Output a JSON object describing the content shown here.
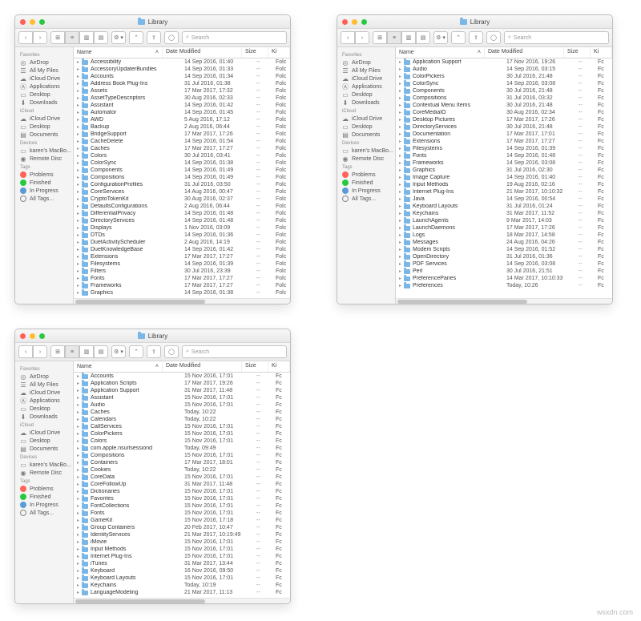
{
  "watermark": "wsxdn.com",
  "window_title_label": "Library",
  "search_placeholder": "Search",
  "columns": {
    "name": "Name",
    "date": "Date Modified",
    "size": "Size",
    "kind": "Ki"
  },
  "sidebar": {
    "groups": [
      {
        "header": "Favorites",
        "items": [
          {
            "icon": "airdrop",
            "label": "AirDrop"
          },
          {
            "icon": "allfiles",
            "label": "All My Files"
          },
          {
            "icon": "cloud",
            "label": "iCloud Drive"
          },
          {
            "icon": "apps",
            "label": "Applications"
          },
          {
            "icon": "desktop",
            "label": "Desktop"
          },
          {
            "icon": "downloads",
            "label": "Downloads"
          }
        ]
      },
      {
        "header": "iCloud",
        "items": [
          {
            "icon": "cloud",
            "label": "iCloud Drive"
          },
          {
            "icon": "desktop",
            "label": "Desktop"
          },
          {
            "icon": "docs",
            "label": "Documents"
          }
        ]
      },
      {
        "header": "Devices",
        "items": [
          {
            "icon": "mac",
            "label": "karen's MacBo..."
          },
          {
            "icon": "disc",
            "label": "Remote Disc"
          }
        ]
      },
      {
        "header": "Tags",
        "items": [
          {
            "icon": "tag",
            "color": "#ff6259",
            "label": "Problems"
          },
          {
            "icon": "tag",
            "color": "#27c93f",
            "label": "Finished"
          },
          {
            "icon": "tag",
            "color": "#5b9bd5",
            "label": "In Progress"
          },
          {
            "icon": "tag",
            "color": "",
            "label": "All Tags..."
          }
        ]
      }
    ]
  },
  "windows": [
    {
      "rows": [
        {
          "n": "Accessibility",
          "d": "14 Sep 2016, 01:40",
          "s": "--",
          "k": "Folc"
        },
        {
          "n": "AccessoryUpdaterBundles",
          "d": "14 Sep 2016, 01:33",
          "s": "--",
          "k": "Folc"
        },
        {
          "n": "Accounts",
          "d": "14 Sep 2016, 01:34",
          "s": "--",
          "k": "Folc"
        },
        {
          "n": "Address Book Plug-Ins",
          "d": "31 Jul 2016, 01:38",
          "s": "--",
          "k": "Folc"
        },
        {
          "n": "Assets",
          "d": "17 Mar 2017, 17:32",
          "s": "--",
          "k": "Folc"
        },
        {
          "n": "AssetTypeDescriptors",
          "d": "30 Aug 2016, 02:33",
          "s": "--",
          "k": "Folc"
        },
        {
          "n": "Assistant",
          "d": "14 Sep 2016, 01:42",
          "s": "--",
          "k": "Folc"
        },
        {
          "n": "Automator",
          "d": "14 Sep 2016, 01:45",
          "s": "--",
          "k": "Folc"
        },
        {
          "n": "AWD",
          "d": "5 Aug 2016, 17:12",
          "s": "--",
          "k": "Folc"
        },
        {
          "n": "Backup",
          "d": "2 Aug 2016, 06:44",
          "s": "--",
          "k": "Folc"
        },
        {
          "n": "BridgeSupport",
          "d": "17 Mar 2017, 17:26",
          "s": "--",
          "k": "Folc"
        },
        {
          "n": "CacheDelete",
          "d": "14 Sep 2016, 01:54",
          "s": "--",
          "k": "Folc"
        },
        {
          "n": "Caches",
          "d": "17 Mar 2017, 17:27",
          "s": "--",
          "k": "Folc"
        },
        {
          "n": "Colors",
          "d": "30 Jul 2016, 03:41",
          "s": "--",
          "k": "Folc"
        },
        {
          "n": "ColorSync",
          "d": "14 Sep 2016, 01:38",
          "s": "--",
          "k": "Folc"
        },
        {
          "n": "Components",
          "d": "14 Sep 2016, 01:49",
          "s": "--",
          "k": "Folc"
        },
        {
          "n": "Compositions",
          "d": "14 Sep 2016, 01:49",
          "s": "--",
          "k": "Folc"
        },
        {
          "n": "ConfigurationProfiles",
          "d": "31 Jul 2016, 03:50",
          "s": "--",
          "k": "Folc"
        },
        {
          "n": "CoreServices",
          "d": "14 Aug 2016, 00:47",
          "s": "--",
          "k": "Folc"
        },
        {
          "n": "CryptoTokenKit",
          "d": "30 Aug 2016, 02:37",
          "s": "--",
          "k": "Folc"
        },
        {
          "n": "DefaultsConfigurations",
          "d": "2 Aug 2016, 06:44",
          "s": "--",
          "k": "Folc"
        },
        {
          "n": "DifferentialPrivacy",
          "d": "14 Sep 2016, 01:48",
          "s": "--",
          "k": "Folc"
        },
        {
          "n": "DirectoryServices",
          "d": "14 Sep 2016, 01:48",
          "s": "--",
          "k": "Folc"
        },
        {
          "n": "Displays",
          "d": "1 Nov 2016, 03:09",
          "s": "--",
          "k": "Folc"
        },
        {
          "n": "DTDs",
          "d": "14 Sep 2016, 01:36",
          "s": "--",
          "k": "Folc"
        },
        {
          "n": "DuetActivityScheduler",
          "d": "2 Aug 2016, 14:19",
          "s": "--",
          "k": "Folc"
        },
        {
          "n": "DuetKnowledgeBase",
          "d": "14 Sep 2016, 01:42",
          "s": "--",
          "k": "Folc"
        },
        {
          "n": "Extensions",
          "d": "17 Mar 2017, 17:27",
          "s": "--",
          "k": "Folc"
        },
        {
          "n": "Filesystems",
          "d": "14 Sep 2016, 01:39",
          "s": "--",
          "k": "Folc"
        },
        {
          "n": "Filters",
          "d": "30 Jul 2016, 23:39",
          "s": "--",
          "k": "Folc"
        },
        {
          "n": "Fonts",
          "d": "17 Mar 2017, 17:27",
          "s": "--",
          "k": "Folc"
        },
        {
          "n": "Frameworks",
          "d": "17 Mar 2017, 17:27",
          "s": "--",
          "k": "Folc"
        },
        {
          "n": "Graphics",
          "d": "14 Sep 2016, 01:38",
          "s": "--",
          "k": "Folc"
        }
      ]
    },
    {
      "rows": [
        {
          "n": "Application Support",
          "d": "17 Nov 2016, 19:26",
          "s": "--",
          "k": "Fc"
        },
        {
          "n": "Audio",
          "d": "14 Sep 2016, 03:15",
          "s": "--",
          "k": "Fc"
        },
        {
          "n": "ColorPickers",
          "d": "30 Jul 2016, 21:48",
          "s": "--",
          "k": "Fc"
        },
        {
          "n": "ColorSync",
          "d": "14 Sep 2016, 03:08",
          "s": "--",
          "k": "Fc"
        },
        {
          "n": "Components",
          "d": "30 Jul 2016, 21:48",
          "s": "--",
          "k": "Fc"
        },
        {
          "n": "Compositions",
          "d": "31 Jul 2016, 03:32",
          "s": "--",
          "k": "Fc"
        },
        {
          "n": "Contextual Menu Items",
          "d": "30 Jul 2016, 21:48",
          "s": "--",
          "k": "Fc"
        },
        {
          "n": "CoreMediaIO",
          "d": "30 Aug 2016, 02:34",
          "s": "--",
          "k": "Fc"
        },
        {
          "n": "Desktop Pictures",
          "d": "17 Mar 2017, 17:26",
          "s": "--",
          "k": "Fc"
        },
        {
          "n": "DirectoryServices",
          "d": "30 Jul 2016, 21:48",
          "s": "--",
          "k": "Fc"
        },
        {
          "n": "Documentation",
          "d": "17 Mar 2017, 17:01",
          "s": "--",
          "k": "Fc"
        },
        {
          "n": "Extensions",
          "d": "17 Mar 2017, 17:27",
          "s": "--",
          "k": "Fc"
        },
        {
          "n": "Filesystems",
          "d": "14 Sep 2016, 01:39",
          "s": "--",
          "k": "Fc"
        },
        {
          "n": "Fonts",
          "d": "14 Sep 2016, 01:48",
          "s": "--",
          "k": "Fc"
        },
        {
          "n": "Frameworks",
          "d": "14 Sep 2016, 03:08",
          "s": "--",
          "k": "Fc"
        },
        {
          "n": "Graphics",
          "d": "31 Jul 2016, 02:30",
          "s": "--",
          "k": "Fc"
        },
        {
          "n": "Image Capture",
          "d": "14 Sep 2016, 01:40",
          "s": "--",
          "k": "Fc"
        },
        {
          "n": "Input Methods",
          "d": "19 Aug 2016, 02:16",
          "s": "--",
          "k": "Fc"
        },
        {
          "n": "Internet Plug-Ins",
          "d": "21 Mar 2017, 10:10:32",
          "s": "--",
          "k": "Fc"
        },
        {
          "n": "Java",
          "d": "14 Sep 2016, 00:54",
          "s": "--",
          "k": "Fc"
        },
        {
          "n": "Keyboard Layouts",
          "d": "31 Jul 2016, 01:24",
          "s": "--",
          "k": "Fc"
        },
        {
          "n": "Keychains",
          "d": "31 Mar 2017, 11:52",
          "s": "--",
          "k": "Fc"
        },
        {
          "n": "LaunchAgents",
          "d": "9 Mar 2017, 14:03",
          "s": "--",
          "k": "Fc"
        },
        {
          "n": "LaunchDaemons",
          "d": "17 Mar 2017, 17:26",
          "s": "--",
          "k": "Fc"
        },
        {
          "n": "Logs",
          "d": "18 Mar 2017, 14:58",
          "s": "--",
          "k": "Fc"
        },
        {
          "n": "Messages",
          "d": "24 Aug 2016, 04:26",
          "s": "--",
          "k": "Fc"
        },
        {
          "n": "Modem Scripts",
          "d": "14 Sep 2016, 01:52",
          "s": "--",
          "k": "Fc"
        },
        {
          "n": "OpenDirectory",
          "d": "31 Jul 2016, 01:36",
          "s": "--",
          "k": "Fc"
        },
        {
          "n": "PDF Services",
          "d": "14 Sep 2016, 03:08",
          "s": "--",
          "k": "Fc"
        },
        {
          "n": "Perl",
          "d": "30 Jul 2016, 21:51",
          "s": "--",
          "k": "Fc"
        },
        {
          "n": "PreferencePanes",
          "d": "14 Mar 2017, 10:10:33",
          "s": "--",
          "k": "Fc"
        },
        {
          "n": "Preferences",
          "d": "Today, 10:26",
          "s": "--",
          "k": "Fc"
        }
      ]
    },
    {
      "rows": [
        {
          "n": "Accounts",
          "d": "15 Nov 2016, 17:01",
          "s": "--",
          "k": "Fc"
        },
        {
          "n": "Application Scripts",
          "d": "17 Mar 2017, 19:26",
          "s": "--",
          "k": "Fc"
        },
        {
          "n": "Application Support",
          "d": "31 Mar 2017, 11:48",
          "s": "--",
          "k": "Fc"
        },
        {
          "n": "Assistant",
          "d": "15 Nov 2016, 17:01",
          "s": "--",
          "k": "Fc"
        },
        {
          "n": "Audio",
          "d": "15 Nov 2016, 17:01",
          "s": "--",
          "k": "Fc"
        },
        {
          "n": "Caches",
          "d": "Today, 10:22",
          "s": "--",
          "k": "Fc"
        },
        {
          "n": "Calendars",
          "d": "Today, 10:22",
          "s": "--",
          "k": "Fc"
        },
        {
          "n": "CallServices",
          "d": "15 Nov 2016, 17:01",
          "s": "--",
          "k": "Fc"
        },
        {
          "n": "ColorPickers",
          "d": "15 Nov 2016, 17:01",
          "s": "--",
          "k": "Fc"
        },
        {
          "n": "Colors",
          "d": "15 Nov 2016, 17:01",
          "s": "--",
          "k": "Fc"
        },
        {
          "n": "com.apple.nsurlsessiond",
          "d": "Today, 09:49",
          "s": "--",
          "k": "Fc"
        },
        {
          "n": "Compositions",
          "d": "15 Nov 2016, 17:01",
          "s": "--",
          "k": "Fc"
        },
        {
          "n": "Containers",
          "d": "17 Mar 2017, 18:01",
          "s": "--",
          "k": "Fc"
        },
        {
          "n": "Cookies",
          "d": "Today, 10:22",
          "s": "--",
          "k": "Fc"
        },
        {
          "n": "CoreData",
          "d": "15 Nov 2016, 17:01",
          "s": "--",
          "k": "Fc"
        },
        {
          "n": "CoreFollowUp",
          "d": "31 Mar 2017, 11:48",
          "s": "--",
          "k": "Fc"
        },
        {
          "n": "Dictionaries",
          "d": "15 Nov 2016, 17:01",
          "s": "--",
          "k": "Fc"
        },
        {
          "n": "Favorites",
          "d": "15 Nov 2016, 17:01",
          "s": "--",
          "k": "Fc"
        },
        {
          "n": "FontCollections",
          "d": "15 Nov 2016, 17:01",
          "s": "--",
          "k": "Fc"
        },
        {
          "n": "Fonts",
          "d": "15 Nov 2016, 17:01",
          "s": "--",
          "k": "Fc"
        },
        {
          "n": "GameKit",
          "d": "15 Nov 2016, 17:18",
          "s": "--",
          "k": "Fc"
        },
        {
          "n": "Group Containers",
          "d": "20 Feb 2017, 10:47",
          "s": "--",
          "k": "Fc"
        },
        {
          "n": "IdentityServices",
          "d": "21 Mar 2017, 10:19:49",
          "s": "--",
          "k": "Fc"
        },
        {
          "n": "iMovie",
          "d": "15 Nov 2016, 17:01",
          "s": "--",
          "k": "Fc"
        },
        {
          "n": "Input Methods",
          "d": "15 Nov 2016, 17:01",
          "s": "--",
          "k": "Fc"
        },
        {
          "n": "Internet Plug-Ins",
          "d": "15 Nov 2016, 17:01",
          "s": "--",
          "k": "Fc"
        },
        {
          "n": "iTunes",
          "d": "31 Mar 2017, 13:44",
          "s": "--",
          "k": "Fc"
        },
        {
          "n": "Keyboard",
          "d": "16 Nov 2016, 09:50",
          "s": "--",
          "k": "Fc"
        },
        {
          "n": "Keyboard Layouts",
          "d": "15 Nov 2016, 17:01",
          "s": "--",
          "k": "Fc"
        },
        {
          "n": "Keychains",
          "d": "Today, 10:19",
          "s": "--",
          "k": "Fc"
        },
        {
          "n": "LanguageModeling",
          "d": "21 Mar 2017, 11:13",
          "s": "--",
          "k": "Fc"
        }
      ]
    }
  ]
}
